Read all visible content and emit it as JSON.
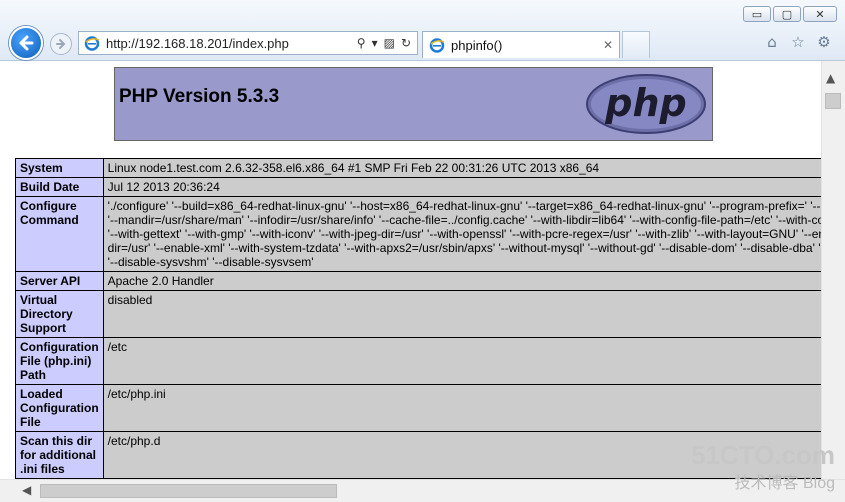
{
  "browser": {
    "url": "http://192.168.18.201/index.php",
    "tab_title": "phpinfo()",
    "window_controls": {
      "minimize": "▭",
      "maximize": "▢",
      "close": "✕"
    }
  },
  "page": {
    "title": "PHP Version 5.3.3",
    "logo_text": "php",
    "rows": [
      {
        "label": "System",
        "value": [
          "Linux node1.test.com 2.6.32-358.el6.x86_64 #1 SMP Fri Feb 22 00:31:26 UTC 2013 x86_64"
        ]
      },
      {
        "label": "Build Date",
        "value": [
          "Jul 12 2013 20:36:24"
        ]
      },
      {
        "label": "Configure Command",
        "value": [
          "'./configure' '--build=x86_64-redhat-linux-gnu' '--host=x86_64-redhat-linux-gnu' '--target=x86_64-redhat-linux-gnu' '--program-prefix=' '--p",
          "'--mandir=/usr/share/man' '--infodir=/usr/share/info' '--cache-file=../config.cache' '--with-libdir=lib64' '--with-config-file-path=/etc' '--with-co",
          "'--with-gettext' '--with-gmp' '--with-iconv' '--with-jpeg-dir=/usr' '--with-openssl' '--with-pcre-regex=/usr' '--with-zlib' '--with-layout=GNU' '--en",
          "dir=/usr' '--enable-xml' '--with-system-tzdata' '--with-apxs2=/usr/sbin/apxs' '--without-mysql' '--without-gd' '--disable-dom' '--disable-dba' '-",
          "'--disable-sysvshm' '--disable-sysvsem'"
        ]
      },
      {
        "label": "Server API",
        "value": [
          "Apache 2.0 Handler"
        ]
      },
      {
        "label": "Virtual Directory Support",
        "value": [
          "disabled"
        ]
      },
      {
        "label": "Configuration File (php.ini) Path",
        "value": [
          "/etc"
        ]
      },
      {
        "label": "Loaded Configuration File",
        "value": [
          "/etc/php.ini"
        ]
      },
      {
        "label": "Scan this dir for additional .ini files",
        "value": [
          "/etc/php.d"
        ]
      }
    ]
  },
  "watermark": {
    "line1": "51CTO.com",
    "line2": "技术博客",
    "line3": "Blog"
  }
}
